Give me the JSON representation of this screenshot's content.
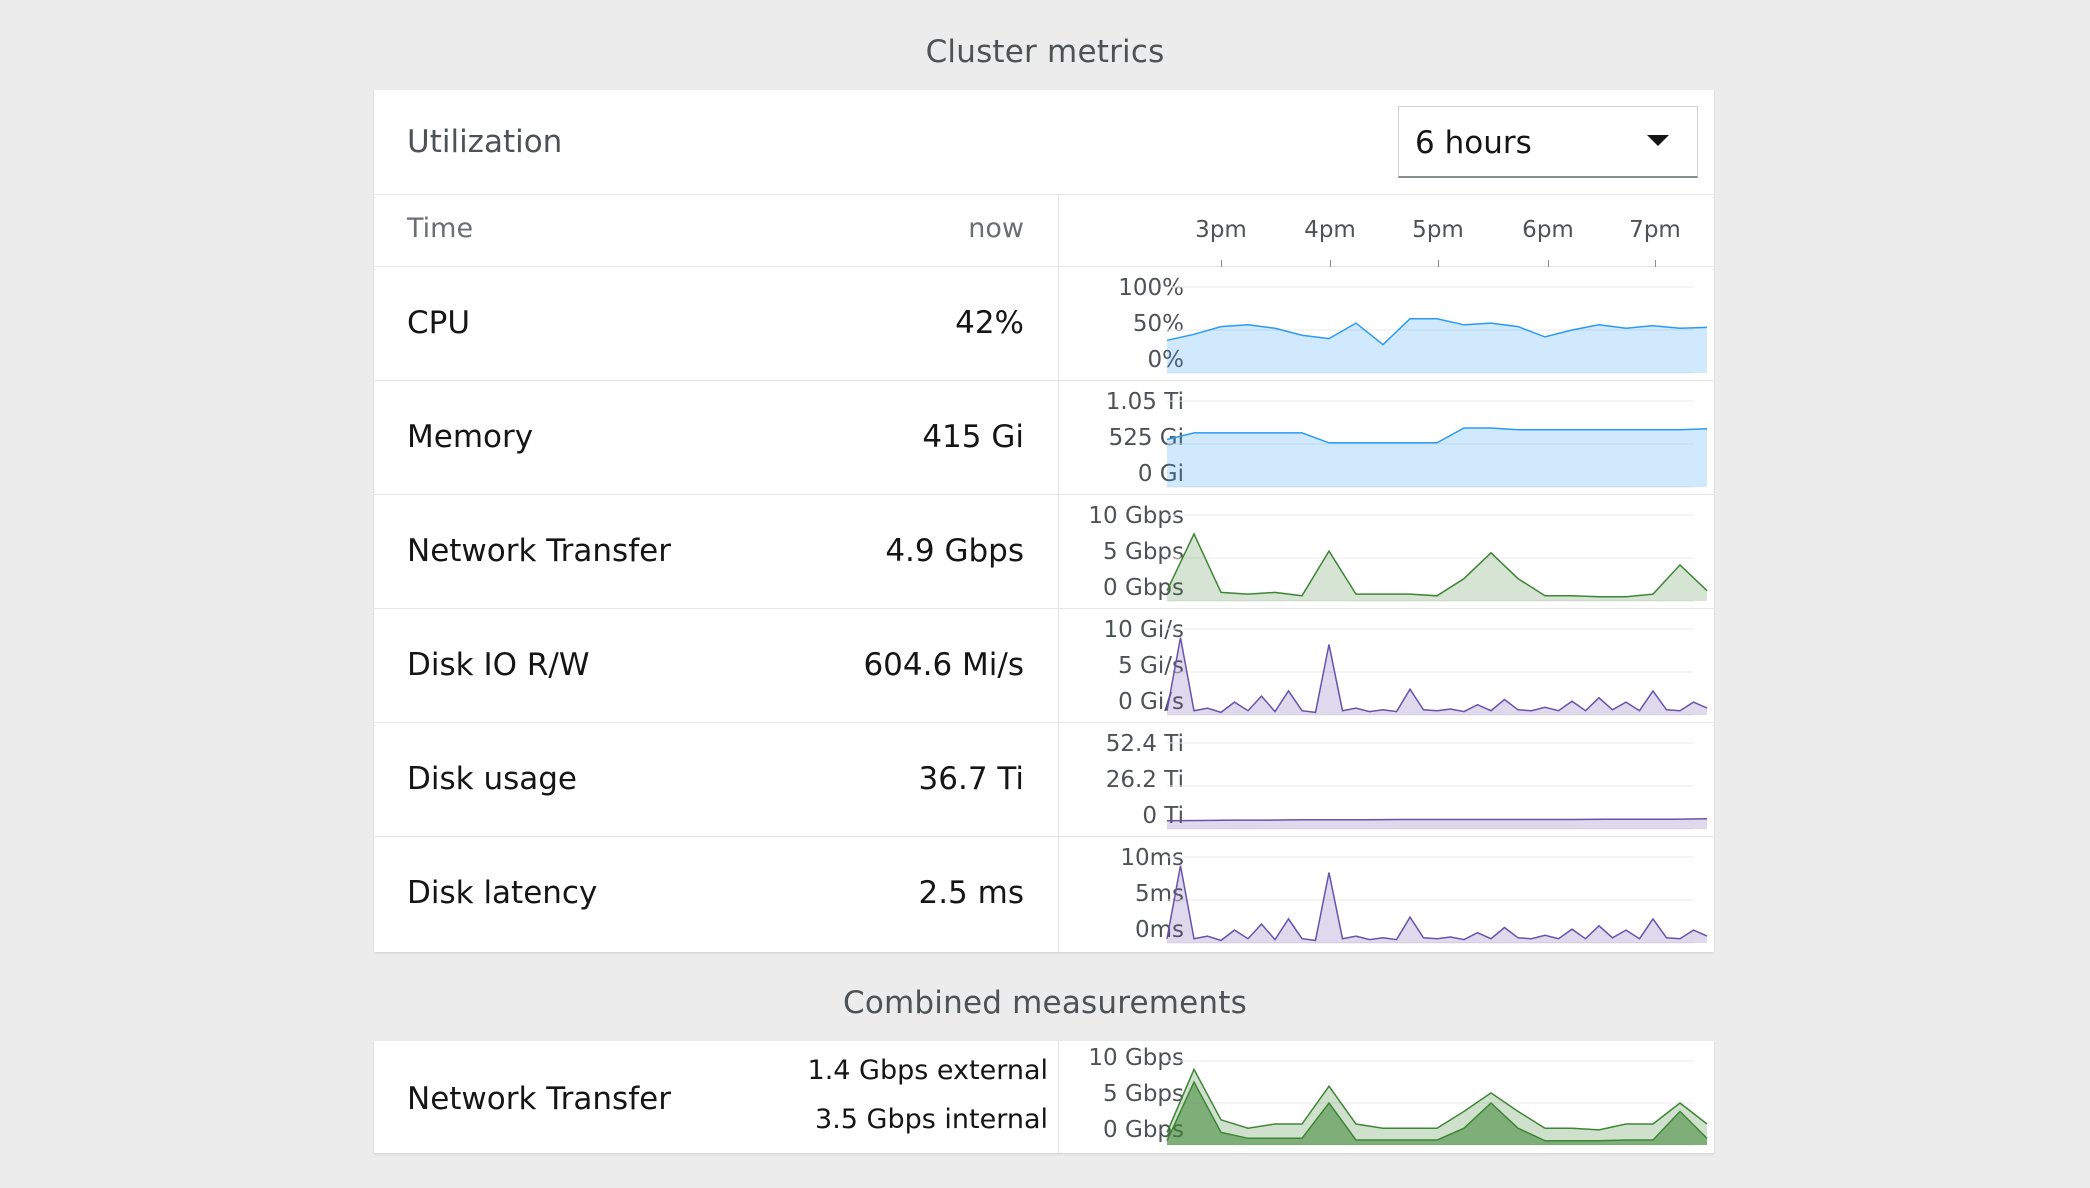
{
  "titles": {
    "cluster": "Cluster metrics",
    "combined": "Combined measurements"
  },
  "utilization": {
    "title": "Utilization",
    "range_selected": "6 hours",
    "time_header": "Time",
    "now_header": "now",
    "time_ticks": [
      "3pm",
      "4pm",
      "5pm",
      "6pm",
      "7pm"
    ]
  },
  "metrics": [
    {
      "name": "CPU",
      "value": "42%",
      "y_labels": [
        "100%",
        "50%",
        "0%"
      ]
    },
    {
      "name": "Memory",
      "value": "415 Gi",
      "y_labels": [
        "1.05 Ti",
        "525 Gi",
        "0 Gi"
      ]
    },
    {
      "name": "Network Transfer",
      "value": "4.9 Gbps",
      "y_labels": [
        "10 Gbps",
        "5 Gbps",
        "0 Gbps"
      ]
    },
    {
      "name": "Disk IO R/W",
      "value": "604.6 Mi/s",
      "y_labels": [
        "10 Gi/s",
        "5 Gi/s",
        "0 Gi/s"
      ]
    },
    {
      "name": "Disk usage",
      "value": "36.7 Ti",
      "y_labels": [
        "52.4 Ti",
        "26.2 Ti",
        "0 Ti"
      ]
    },
    {
      "name": "Disk latency",
      "value": "2.5 ms",
      "y_labels": [
        "10ms",
        "5ms",
        "0ms"
      ]
    }
  ],
  "combined": {
    "name": "Network Transfer",
    "external": "1.4 Gbps external",
    "internal": "3.5 Gbps internal",
    "y_labels": [
      "10 Gbps",
      "5 Gbps",
      "0 Gbps"
    ]
  },
  "colors": {
    "cpu": "#2b9af3",
    "memory": "#2b9af3",
    "network": "#3e8635",
    "disk": "#6753ac"
  },
  "chart_data": [
    {
      "type": "area",
      "title": "CPU",
      "unit": "%",
      "ylim": [
        0,
        100
      ],
      "values": [
        38,
        45,
        54,
        56,
        52,
        44,
        40,
        58,
        33,
        63,
        63,
        56,
        58,
        54,
        42,
        50,
        56,
        52,
        55,
        52,
        53
      ]
    },
    {
      "type": "area",
      "title": "Memory",
      "unit": "Gi",
      "ylim": [
        0,
        1050
      ],
      "values": [
        580,
        660,
        660,
        660,
        660,
        660,
        540,
        540,
        540,
        540,
        540,
        720,
        720,
        700,
        700,
        700,
        700,
        700,
        700,
        700,
        710
      ]
    },
    {
      "type": "area",
      "title": "Network Transfer",
      "unit": "Gbps",
      "ylim": [
        0,
        10
      ],
      "values": [
        1.2,
        7.8,
        1.0,
        0.8,
        1.0,
        0.6,
        5.8,
        0.8,
        0.8,
        0.8,
        0.6,
        2.6,
        5.6,
        2.6,
        0.6,
        0.6,
        0.5,
        0.5,
        0.8,
        4.2,
        1.2
      ]
    },
    {
      "type": "area",
      "title": "Disk IO R/W",
      "unit": "Gi/s",
      "ylim": [
        0,
        10
      ],
      "values": [
        0.5,
        9.0,
        0.5,
        0.8,
        0.3,
        1.5,
        0.5,
        2.2,
        0.4,
        2.8,
        0.5,
        0.3,
        8.2,
        0.5,
        0.8,
        0.4,
        0.6,
        0.4,
        3.0,
        0.6,
        0.5,
        0.7,
        0.4,
        1.2,
        0.5,
        1.8,
        0.6,
        0.5,
        0.9,
        0.5,
        1.6,
        0.5,
        2.0,
        0.6,
        1.5,
        0.5,
        2.8,
        0.6,
        0.5,
        1.5,
        0.8
      ]
    },
    {
      "type": "area",
      "title": "Disk usage",
      "unit": "Ti",
      "ylim": [
        0,
        52.4
      ],
      "values": [
        5.0,
        5.2,
        5.4,
        5.4,
        5.6,
        5.6,
        5.6,
        5.8,
        5.8,
        5.8,
        5.8,
        5.8,
        5.8,
        6.0,
        6.0,
        6.0,
        6.2
      ]
    },
    {
      "type": "area",
      "title": "Disk latency",
      "unit": "ms",
      "ylim": [
        0,
        10
      ],
      "values": [
        0.5,
        9.0,
        0.5,
        0.8,
        0.3,
        1.5,
        0.5,
        2.2,
        0.4,
        2.8,
        0.5,
        0.3,
        8.2,
        0.5,
        0.8,
        0.4,
        0.6,
        0.4,
        3.0,
        0.6,
        0.5,
        0.7,
        0.4,
        1.2,
        0.5,
        1.8,
        0.6,
        0.5,
        0.9,
        0.5,
        1.6,
        0.5,
        2.0,
        0.6,
        1.5,
        0.5,
        2.8,
        0.6,
        0.5,
        1.5,
        0.8
      ]
    },
    {
      "type": "area",
      "title": "Network Transfer",
      "unit": "Gbps",
      "ylim": [
        0,
        10
      ],
      "series": [
        {
          "name": "external",
          "values": [
            1.5,
            9.0,
            3.0,
            2.0,
            2.5,
            2.5,
            7.0,
            2.5,
            2.0,
            2.0,
            2.0,
            4.0,
            6.2,
            4.0,
            2.0,
            2.0,
            1.8,
            2.5,
            2.5,
            5.0,
            2.5
          ]
        },
        {
          "name": "internal",
          "values": [
            0.5,
            7.5,
            1.5,
            0.8,
            0.8,
            0.8,
            5.0,
            0.6,
            0.6,
            0.6,
            0.6,
            2.0,
            5.0,
            2.0,
            0.5,
            0.5,
            0.5,
            0.6,
            0.6,
            4.0,
            0.8
          ]
        }
      ]
    }
  ]
}
